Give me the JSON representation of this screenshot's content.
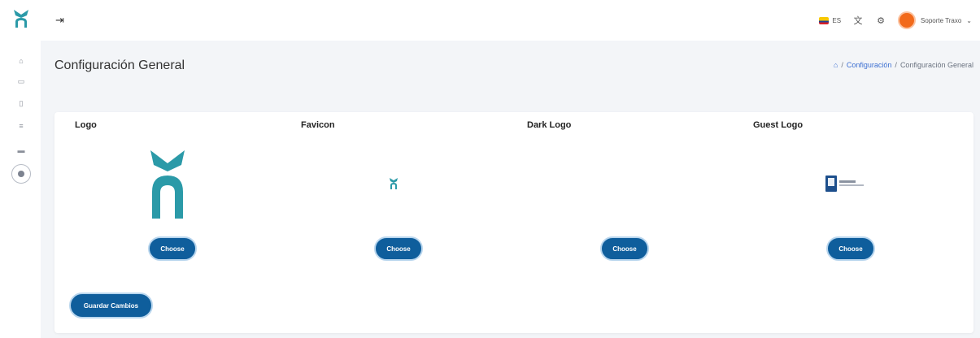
{
  "header": {
    "collapse_icon": "arrow-right-icon",
    "language": "ES",
    "user_name": "Soporte Traxo"
  },
  "sidebar": {
    "items": [
      {
        "icon": "home-icon"
      },
      {
        "icon": "calendar-icon"
      },
      {
        "icon": "document-icon"
      },
      {
        "icon": "list-icon"
      },
      {
        "icon": "card-icon"
      },
      {
        "icon": "settings-icon"
      }
    ]
  },
  "page": {
    "title": "Configuración General",
    "breadcrumb": {
      "home_icon": "home-icon",
      "level1": "Configuración",
      "current": "Configuración General"
    }
  },
  "logos": {
    "columns": [
      {
        "title": "Logo",
        "button": "Choose"
      },
      {
        "title": "Favicon",
        "button": "Choose"
      },
      {
        "title": "Dark Logo",
        "button": "Choose"
      },
      {
        "title": "Guest Logo",
        "button": "Choose"
      }
    ],
    "save_label": "Guardar Cambios"
  },
  "colors": {
    "primary": "#0f5e9c",
    "brand": "#2b9aa8",
    "background": "#f3f5f8",
    "avatar": "#f26a1b"
  }
}
